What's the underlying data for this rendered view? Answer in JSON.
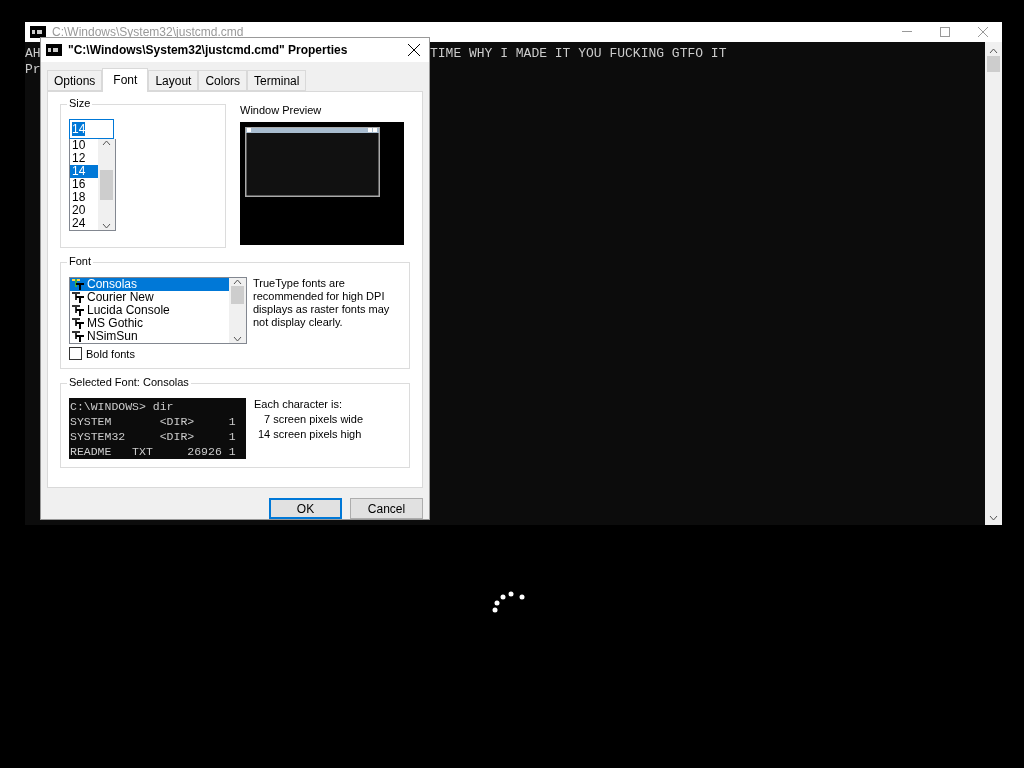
{
  "console_window": {
    "title": "C:\\Windows\\System32\\justcmd.cmd",
    "active": false,
    "lines": [
      {
        "left": "AH",
        "right": "TIME WHY I MADE IT YOU FUCKING GTFO IT"
      },
      {
        "left": "Pr"
      }
    ]
  },
  "dialog": {
    "title": "\"C:\\Windows\\System32\\justcmd.cmd\" Properties",
    "tabs": [
      {
        "label": "Options",
        "selected": false
      },
      {
        "label": "Font",
        "selected": true
      },
      {
        "label": "Layout",
        "selected": false
      },
      {
        "label": "Colors",
        "selected": false
      },
      {
        "label": "Terminal",
        "selected": false
      }
    ],
    "size": {
      "label": "Size",
      "value": "14",
      "items": [
        {
          "label": "10",
          "selected": false
        },
        {
          "label": "12",
          "selected": false
        },
        {
          "label": "14",
          "selected": true
        },
        {
          "label": "16",
          "selected": false
        },
        {
          "label": "18",
          "selected": false
        },
        {
          "label": "20",
          "selected": false
        },
        {
          "label": "24",
          "selected": false
        }
      ]
    },
    "preview": {
      "label": "Window Preview"
    },
    "font": {
      "label": "Font",
      "items": [
        {
          "label": "Consolas",
          "selected": true
        },
        {
          "label": "Courier New",
          "selected": false
        },
        {
          "label": "Lucida Console",
          "selected": false
        },
        {
          "label": "MS Gothic",
          "selected": false
        },
        {
          "label": "NSimSun",
          "selected": false
        }
      ],
      "note": "TrueType fonts are recommended for high DPI displays as raster fonts may not display clearly.",
      "bold": {
        "label": "Bold fonts",
        "checked": false
      }
    },
    "selected_font": {
      "label": "Selected Font: Consolas",
      "sample_lines": [
        "C:\\WINDOWS> dir",
        "SYSTEM       <DIR>     1",
        "SYSTEM32     <DIR>     1",
        "README   TXT     26926 1"
      ],
      "info": [
        "Each character is:",
        "7 screen pixels wide",
        "14 screen pixels high"
      ]
    },
    "buttons": [
      {
        "label": "OK",
        "default": true
      },
      {
        "label": "Cancel",
        "default": false
      }
    ]
  }
}
